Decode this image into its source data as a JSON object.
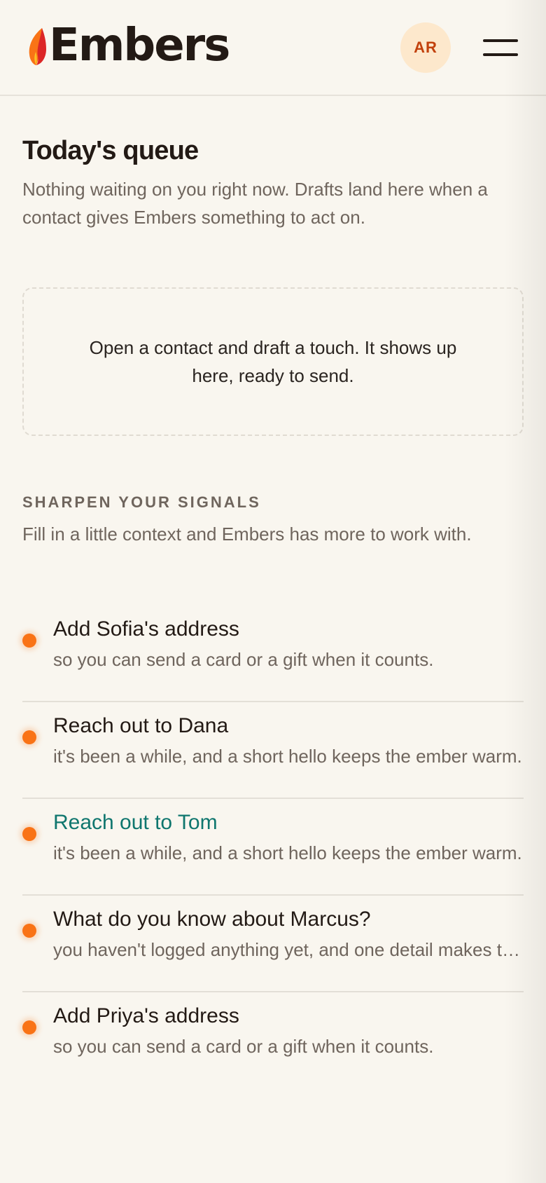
{
  "header": {
    "app_name": "Embers",
    "avatar_initials": "AR"
  },
  "queue": {
    "title": "Today's queue",
    "description": "Nothing waiting on you right now. Drafts land here when a contact gives Embers something to act on.",
    "empty_message": "Open a contact and draft a touch. It shows up here, ready to send."
  },
  "signals": {
    "heading": "SHARPEN YOUR SIGNALS",
    "description": "Fill in a little context and Embers has more to work with.",
    "items": [
      {
        "title": "Add Sofia's address",
        "subtitle": "so you can send a card or a gift when it counts."
      },
      {
        "title": "Reach out to Dana",
        "subtitle": "it's been a while, and a short hello keeps the ember warm."
      },
      {
        "title": "Reach out to Tom",
        "subtitle": "it's been a while, and a short hello keeps the ember warm."
      },
      {
        "title": "What do you know about Marcus?",
        "subtitle": "you haven't logged anything yet, and one detail makes the next touch easier."
      },
      {
        "title": "Add Priya's address",
        "subtitle": "so you can send a card or a gift when it counts."
      }
    ]
  },
  "colors": {
    "background": "#f9f6ef",
    "accent_orange": "#f97316",
    "avatar_bg": "#fde8cc",
    "avatar_text": "#c2410c",
    "highlight_teal": "#0f766e",
    "muted_text": "#6f655d"
  },
  "icons": {
    "logo": "flame-icon",
    "menu": "hamburger-menu-icon",
    "signal_marker": "dot-icon"
  }
}
